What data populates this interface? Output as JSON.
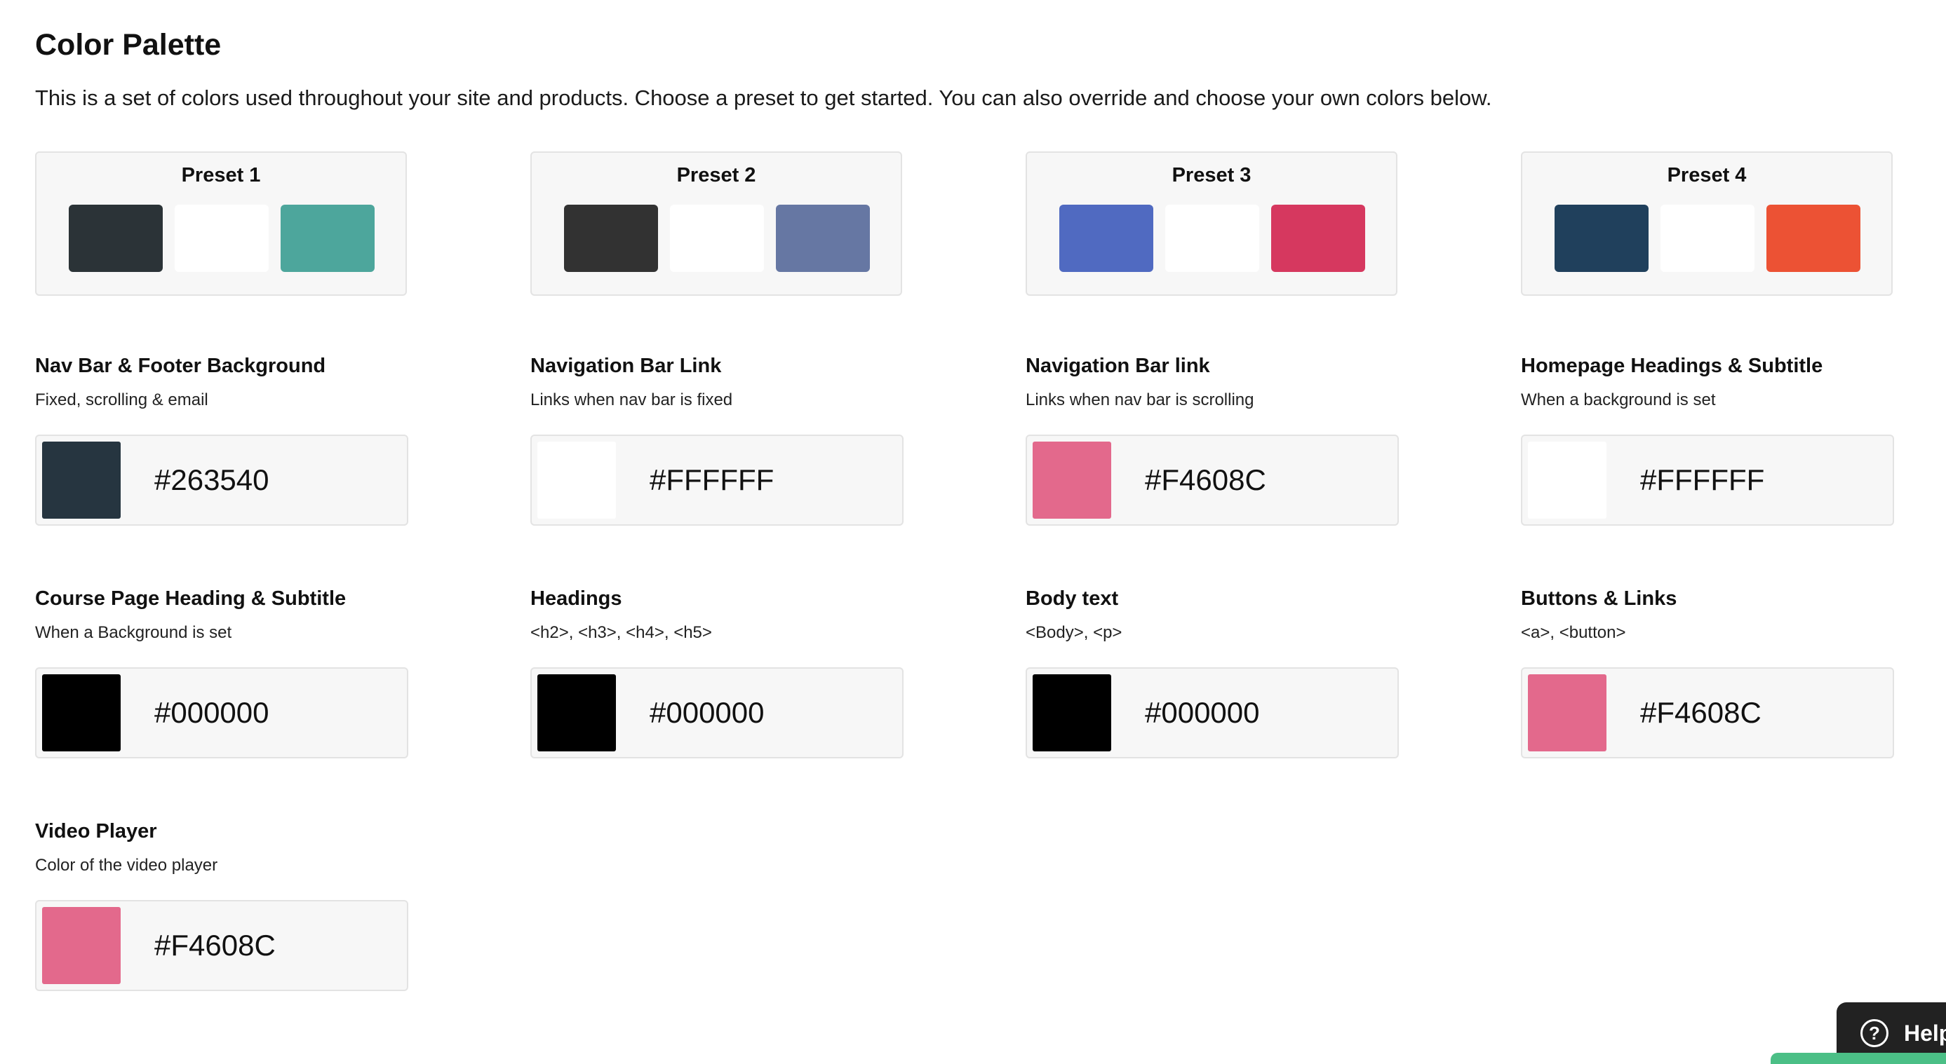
{
  "page": {
    "title": "Color Palette",
    "description": "This is a set of colors used throughout your site and products. Choose a preset to get started. You can also override and choose your own colors below."
  },
  "presets": [
    {
      "label": "Preset 1",
      "colors": [
        "#2b3337",
        "#ffffff",
        "#4da69c"
      ]
    },
    {
      "label": "Preset 2",
      "colors": [
        "#323232",
        "#ffffff",
        "#6677a3"
      ]
    },
    {
      "label": "Preset 3",
      "colors": [
        "#506ac1",
        "#ffffff",
        "#d6385f"
      ]
    },
    {
      "label": "Preset 4",
      "colors": [
        "#20405c",
        "#ffffff",
        "#ec5234"
      ]
    }
  ],
  "fields": [
    {
      "label": "Nav Bar & Footer Background",
      "sub": "Fixed, scrolling & email",
      "value": "#263540",
      "swatch": "#263540"
    },
    {
      "label": "Navigation Bar Link",
      "sub": "Links when nav bar is fixed",
      "value": "#FFFFFF",
      "swatch": "#FFFFFF"
    },
    {
      "label": "Navigation Bar link",
      "sub": "Links when nav bar is scrolling",
      "value": "#F4608C",
      "swatch": "#e3698c"
    },
    {
      "label": "Homepage Headings & Subtitle",
      "sub": "When a background is set",
      "value": "#FFFFFF",
      "swatch": "#FFFFFF"
    },
    {
      "label": "Course Page Heading & Subtitle",
      "sub": "When a Background is set",
      "value": "#000000",
      "swatch": "#000000"
    },
    {
      "label": "Headings",
      "sub": "<h2>, <h3>, <h4>, <h5>",
      "value": "#000000",
      "swatch": "#000000"
    },
    {
      "label": "Body text",
      "sub": "<Body>, <p>",
      "value": "#000000",
      "swatch": "#000000"
    },
    {
      "label": "Buttons & Links",
      "sub": "<a>, <button>",
      "value": "#F4608C",
      "swatch": "#e3698c"
    },
    {
      "label": "Video Player",
      "sub": "Color of the video player",
      "value": "#F4608C",
      "swatch": "#e3698c"
    }
  ],
  "help_widget": {
    "label": "Help",
    "icon": "question-circle-icon"
  },
  "colors": {
    "save_button": "#4bbf86",
    "help_background": "#222222"
  }
}
